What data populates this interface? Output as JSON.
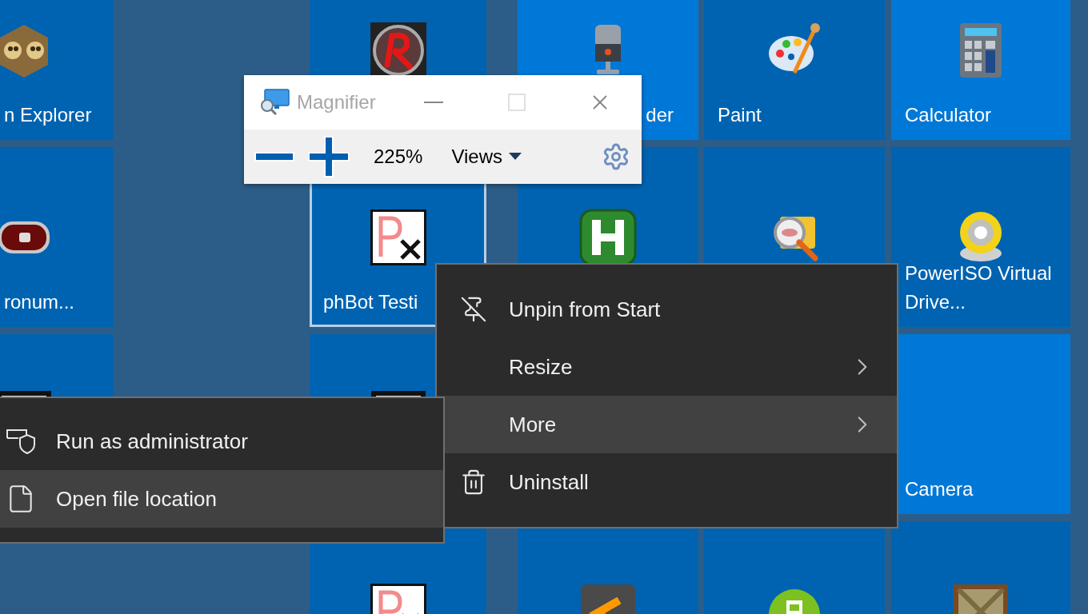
{
  "tile_columns": [
    {
      "tiles": [
        {
          "label": "n Explorer",
          "color": "#0063b1",
          "selected": false
        },
        {
          "label": "ronum...",
          "color": "#0063b1",
          "selected": false
        },
        {
          "color": "#0063b1",
          "selected": false
        }
      ]
    },
    {
      "tiles": [
        {
          "color": "#0063b1",
          "selected": false
        },
        {
          "label": "phBot Testi",
          "color": "#0063b1",
          "selected": true
        },
        {
          "color": "#0063b1",
          "selected": false
        },
        {
          "color": "#0063b1",
          "selected": false
        }
      ]
    },
    {
      "tiles": [
        {
          "label": "der",
          "color": "#0078d7",
          "selected": false
        },
        {
          "color": "#0063b1",
          "selected": false
        },
        {
          "color": "#0063b1",
          "selected": false
        }
      ]
    },
    {
      "tiles": [
        {
          "label": "Paint",
          "color": "#0063b1",
          "selected": false
        },
        {
          "color": "#0063b1",
          "selected": false
        },
        {
          "color": "#0063b1",
          "selected": false
        }
      ]
    },
    {
      "tiles": [
        {
          "label": "Calculator",
          "color": "#0078d7",
          "selected": false
        },
        {
          "label": "PowerISO Virtual Drive...",
          "color": "#0063b1",
          "selected": false
        },
        {
          "label": "Camera",
          "color": "#0078d7",
          "selected": false
        },
        {
          "color": "#0063b1",
          "selected": false
        }
      ]
    }
  ],
  "magnifier": {
    "title": "Magnifier",
    "zoom_level": "225%",
    "views": "Views"
  },
  "context_menu": {
    "items": [
      {
        "label": "Unpin from Start",
        "has_submenu": false,
        "selected": false
      },
      {
        "label": "Resize",
        "has_submenu": true,
        "selected": false
      },
      {
        "label": "More",
        "has_submenu": true,
        "selected": true
      },
      {
        "label": "Uninstall",
        "has_submenu": false,
        "selected": false
      }
    ]
  },
  "submenu": {
    "items": [
      {
        "label": "Run as administrator",
        "selected": false
      },
      {
        "label": "Open file location",
        "selected": true
      }
    ]
  }
}
